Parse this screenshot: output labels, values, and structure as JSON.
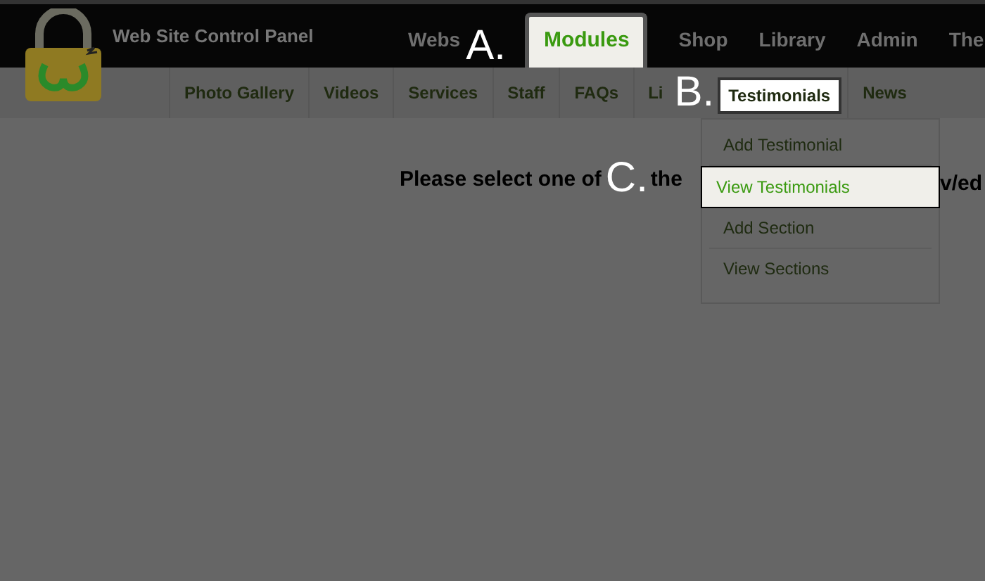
{
  "header": {
    "title": "Web Site Control Panel"
  },
  "main_nav": [
    {
      "label": "Webs",
      "selected": false
    },
    {
      "label": "Modules",
      "selected": true
    },
    {
      "label": "Shop",
      "selected": false
    },
    {
      "label": "Library",
      "selected": false
    },
    {
      "label": "Admin",
      "selected": false
    },
    {
      "label": "The",
      "selected": false
    }
  ],
  "sub_nav": [
    {
      "label": "Photo Gallery",
      "selected": false
    },
    {
      "label": "Videos",
      "selected": false
    },
    {
      "label": "Services",
      "selected": false
    },
    {
      "label": "Staff",
      "selected": false
    },
    {
      "label": "FAQs",
      "selected": false
    },
    {
      "label": "Li",
      "selected": false
    },
    {
      "label": "Testimonials",
      "selected": true
    },
    {
      "label": "News",
      "selected": false
    }
  ],
  "dropdown": [
    {
      "label": "Add Testimonial",
      "selected": false
    },
    {
      "label": "View Testimonials",
      "selected": true
    },
    {
      "label": "Add Section",
      "selected": false
    },
    {
      "label": "View Sections",
      "selected": false
    }
  ],
  "message": {
    "start": "Please select one of",
    "middle": "the",
    "end": "v/ed"
  },
  "annotations": [
    {
      "label": "A."
    },
    {
      "label": "B."
    },
    {
      "label": "C."
    }
  ]
}
